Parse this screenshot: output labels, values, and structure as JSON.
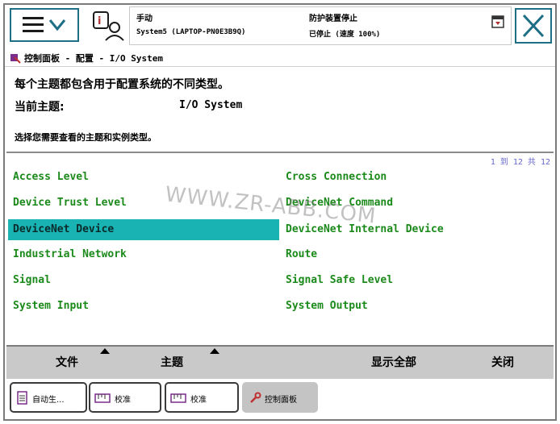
{
  "header": {
    "mode": "手动",
    "system": "System5 (LAPTOP-PN0E3B9Q)",
    "safety_status": "防护装置停止",
    "run_status": "已停止 (速度 100%)"
  },
  "breadcrumb": "控制面板 - 配置 - I/O System",
  "description": {
    "intro": "每个主题都包含用于配置系统的不同类型。",
    "current_topic_label": "当前主题:",
    "current_topic_value": "I/O System",
    "instruction": "选择您需要查看的主题和实例类型。"
  },
  "list": {
    "paging": "1 到 12 共 12",
    "selected": "DeviceNet Device",
    "left_items": [
      "Access Level",
      "Device Trust Level",
      "DeviceNet Device",
      "Industrial Network",
      "Signal",
      "System Input"
    ],
    "right_items": [
      "Cross Connection",
      "DeviceNet Command",
      "DeviceNet Internal Device",
      "Route",
      "Signal Safe Level",
      "System Output"
    ]
  },
  "watermark": "WWW.ZR-ABB.COM",
  "toolbar": {
    "file": "文件",
    "topic": "主题",
    "show_all": "显示全部",
    "close": "关闭"
  },
  "taskbar": {
    "task1": "自动生...",
    "task2": "校准",
    "task3": "校准",
    "task4": "控制面板"
  },
  "colors": {
    "accent_border": "#1e6f86",
    "item_text": "#1b8a1b",
    "selected_bg": "#19b3b3",
    "toolbar_bg": "#c9c9c9"
  }
}
